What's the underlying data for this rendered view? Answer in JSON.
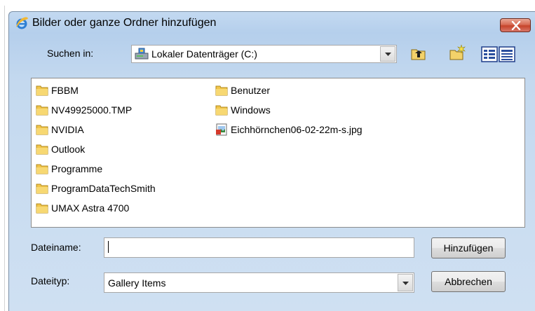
{
  "window": {
    "title": "Bilder oder ganze Ordner hinzufügen"
  },
  "toolbar": {
    "look_in_label": "Suchen in:",
    "look_in_value": "Lokaler Datenträger (C:)"
  },
  "files": [
    {
      "name": "FBBM",
      "kind": "folder"
    },
    {
      "name": "NV49925000.TMP",
      "kind": "folder"
    },
    {
      "name": "NVIDIA",
      "kind": "folder"
    },
    {
      "name": "Outlook",
      "kind": "folder"
    },
    {
      "name": "Programme",
      "kind": "folder"
    },
    {
      "name": "ProgramDataTechSmith",
      "kind": "folder"
    },
    {
      "name": "UMAX Astra 4700",
      "kind": "folder"
    },
    {
      "name": "Benutzer",
      "kind": "folder"
    },
    {
      "name": "Windows",
      "kind": "folder"
    },
    {
      "name": "Eichhörnchen06-02-22m-s.jpg",
      "kind": "image-file"
    }
  ],
  "form": {
    "filename_label": "Dateiname:",
    "filename_value": "",
    "filetype_label": "Dateityp:",
    "filetype_value": "Gallery Items"
  },
  "buttons": {
    "add": "Hinzufügen",
    "cancel": "Abbrechen"
  },
  "icons": {
    "title": "ie-icon",
    "close": "close-icon",
    "drive": "drive-icon",
    "up": "up-folder-icon",
    "new_folder": "new-folder-icon",
    "views": "view-menu-icon"
  },
  "colors": {
    "close_button": "#c6442a",
    "folder": "#f2c54a",
    "title_bar": "#c3d9f1"
  }
}
